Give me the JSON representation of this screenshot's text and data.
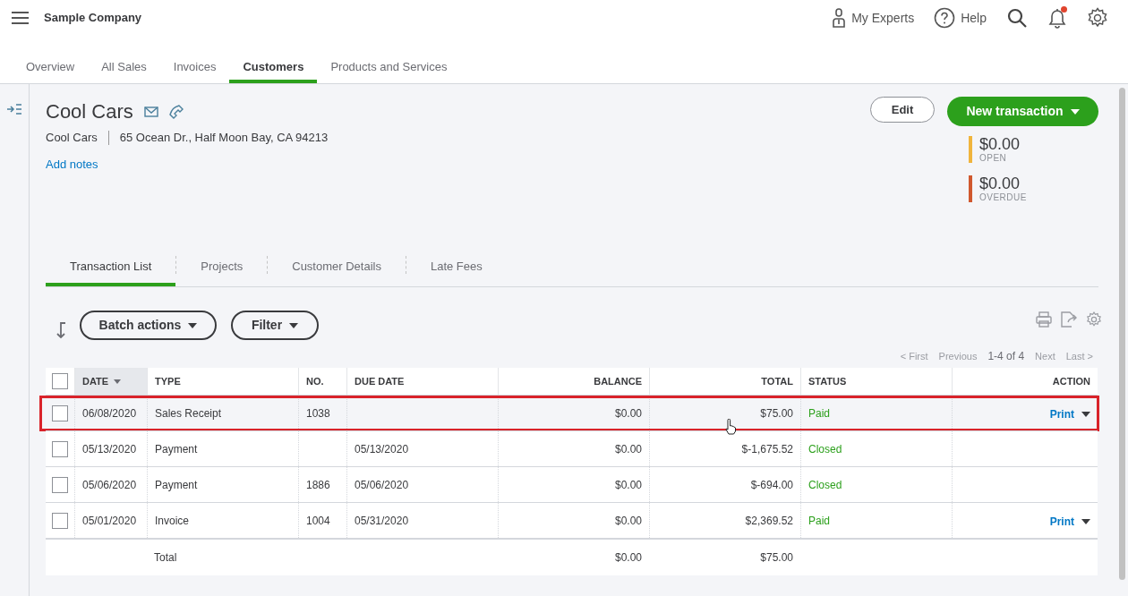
{
  "company": "Sample Company",
  "top_actions": [
    {
      "kind": "experts",
      "label": "My Experts"
    },
    {
      "kind": "help",
      "label": "Help"
    },
    {
      "kind": "search"
    },
    {
      "kind": "bell",
      "badge": true
    },
    {
      "kind": "gear"
    }
  ],
  "nav_tabs": [
    {
      "label": "Overview",
      "selected": false
    },
    {
      "label": "All Sales",
      "selected": false
    },
    {
      "label": "Invoices",
      "selected": false
    },
    {
      "label": "Customers",
      "selected": true
    },
    {
      "label": "Products and Services",
      "selected": false
    }
  ],
  "customer": {
    "name": "Cool Cars",
    "company": "Cool Cars",
    "address": "65 Ocean Dr., Half Moon Bay, CA 94213",
    "add_notes": "Add notes"
  },
  "buttons": {
    "edit": "Edit",
    "new_transaction": "New transaction"
  },
  "summary": [
    {
      "amount": "$0.00",
      "label": "OPEN",
      "color": "#f0b43c"
    },
    {
      "amount": "$0.00",
      "label": "OVERDUE",
      "color": "#d0582e"
    }
  ],
  "sub_tabs": [
    {
      "label": "Transaction List",
      "selected": true
    },
    {
      "label": "Projects",
      "selected": false
    },
    {
      "label": "Customer Details",
      "selected": false
    },
    {
      "label": "Late Fees",
      "selected": false
    }
  ],
  "toolbar": {
    "batch_actions": "Batch actions",
    "filter": "Filter"
  },
  "pagination": {
    "first": "< First",
    "previous": "Previous",
    "range": "1-4 of 4",
    "next": "Next",
    "last": "Last >"
  },
  "table": {
    "select_all_checked": false,
    "columns": [
      {
        "label": "DATE",
        "sorted": true
      },
      {
        "label": "TYPE",
        "sorted": false
      },
      {
        "label": "NO.",
        "sorted": false
      },
      {
        "label": "DUE DATE",
        "sorted": false
      },
      {
        "label": "BALANCE",
        "sorted": false
      },
      {
        "label": "TOTAL",
        "sorted": false
      },
      {
        "label": "STATUS",
        "sorted": false
      },
      {
        "label": "ACTION",
        "sorted": false
      }
    ],
    "rows": [
      {
        "checked": false,
        "highlighted": true,
        "date": "06/08/2020",
        "type": "Sales Receipt",
        "no": "1038",
        "due_date": "",
        "balance": "$0.00",
        "total": "$75.00",
        "status": "Paid",
        "action": "Print"
      },
      {
        "checked": false,
        "highlighted": false,
        "date": "05/13/2020",
        "type": "Payment",
        "no": "",
        "due_date": "05/13/2020",
        "balance": "$0.00",
        "total": "$-1,675.52",
        "status": "Closed",
        "action": ""
      },
      {
        "checked": false,
        "highlighted": false,
        "date": "05/06/2020",
        "type": "Payment",
        "no": "1886",
        "due_date": "05/06/2020",
        "balance": "$0.00",
        "total": "$-694.00",
        "status": "Closed",
        "action": ""
      },
      {
        "checked": false,
        "highlighted": false,
        "date": "05/01/2020",
        "type": "Invoice",
        "no": "1004",
        "due_date": "05/31/2020",
        "balance": "$0.00",
        "total": "$2,369.52",
        "status": "Paid",
        "action": "Print"
      }
    ],
    "total_row": {
      "label": "Total",
      "balance": "$0.00",
      "total": "$75.00"
    }
  }
}
